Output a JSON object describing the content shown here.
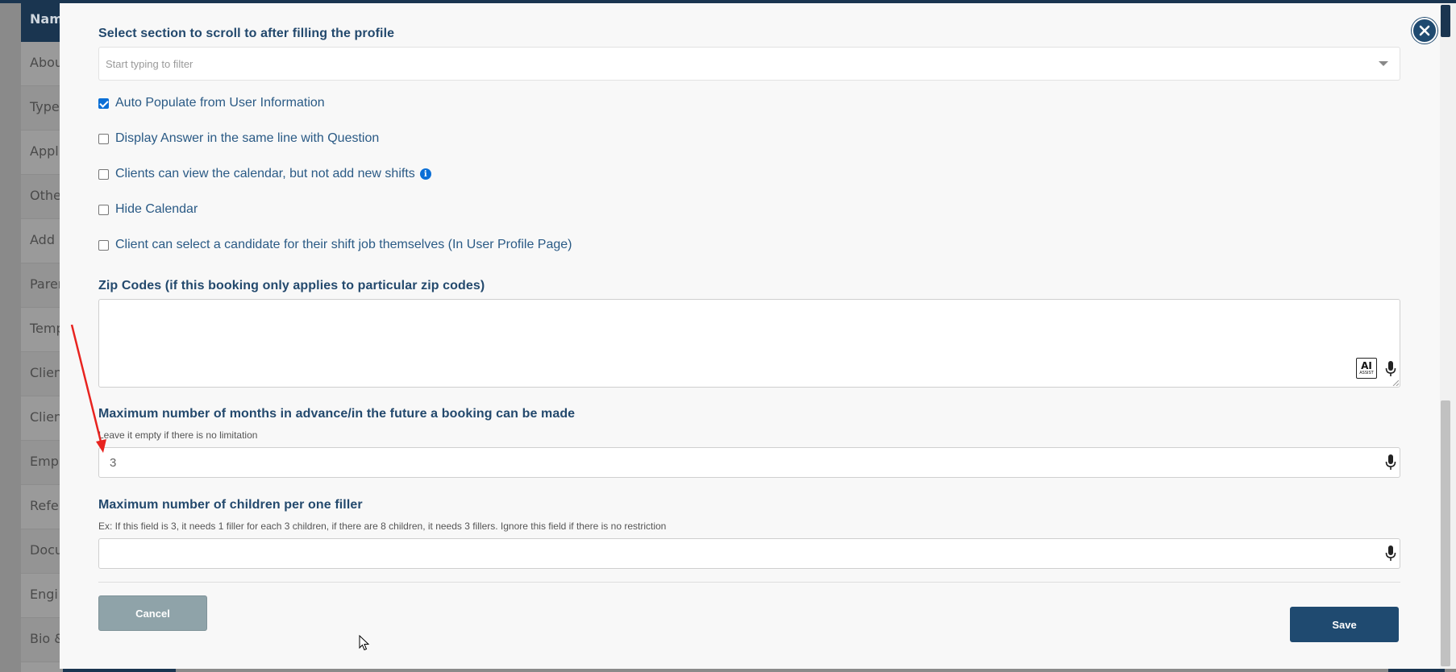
{
  "background": {
    "table_header": "Nam",
    "rows": [
      "Abou",
      "Type",
      "Appli",
      "Othe",
      "Add c",
      "Paren",
      "Temp",
      "Clien",
      "Clien",
      "Empl",
      "Refer",
      "Docu",
      "Engi",
      "Bio &"
    ]
  },
  "modal": {
    "close_label": "✕",
    "scroll_section": {
      "label": "Select section to scroll to after filling the profile",
      "placeholder": "Start typing to filter"
    },
    "checkboxes": [
      {
        "label": "Auto Populate from User Information",
        "checked": true
      },
      {
        "label": "Display Answer in the same line with Question",
        "checked": false
      },
      {
        "label": "Clients can view the calendar, but not add new shifts",
        "checked": false,
        "info": "i"
      },
      {
        "label": "Hide Calendar",
        "checked": false
      },
      {
        "label": "Client can select a candidate for their shift job themselves (In User Profile Page)",
        "checked": false
      }
    ],
    "zip_codes": {
      "label": "Zip Codes (if this booking only applies to particular zip codes)",
      "value": "",
      "ai_badge_big": "AI",
      "ai_badge_small": "ASSIST"
    },
    "max_months": {
      "label": "Maximum number of months in advance/in the future a booking can be made",
      "hint": "Leave it empty if there is no limitation",
      "value": "3"
    },
    "max_children": {
      "label": "Maximum number of children per one filler",
      "hint": "Ex: If this field is 3, it needs 1 filler for each 3 children, if there are 8 children, it needs 3 fillers. Ignore this field if there is no restriction",
      "value": ""
    },
    "cancel_label": "Cancel",
    "save_label": "Save"
  },
  "colors": {
    "primary": "#1f4a70",
    "label_text": "#23496d",
    "checkbox_accent": "#0b6fd6",
    "cancel_bg": "#8fa3a9",
    "annotation_arrow": "#e8231f"
  }
}
